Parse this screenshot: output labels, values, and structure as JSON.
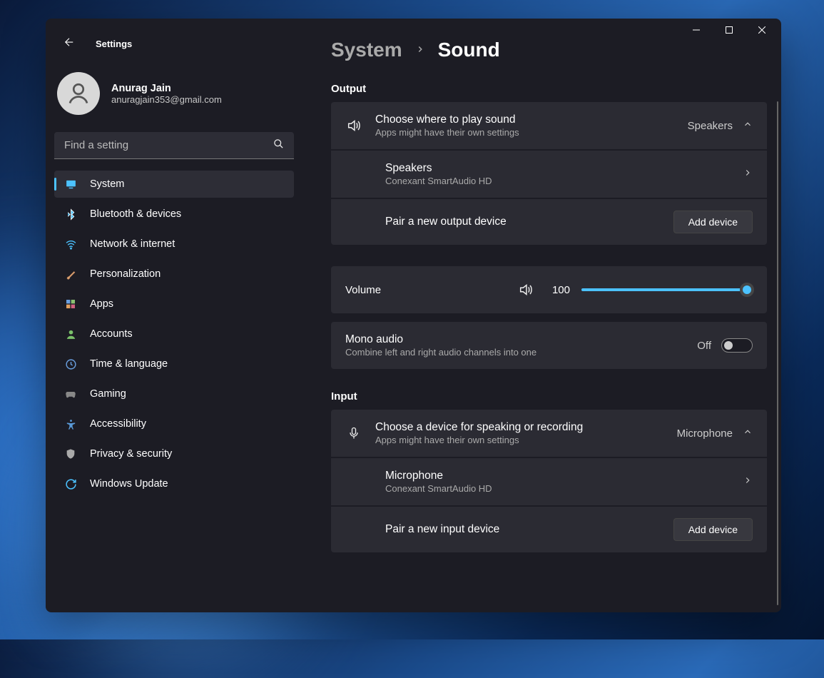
{
  "app_title": "Settings",
  "user": {
    "name": "Anurag Jain",
    "email": "anuragjain353@gmail.com"
  },
  "search": {
    "placeholder": "Find a setting"
  },
  "nav": [
    {
      "label": "System",
      "icon": "display",
      "active": true
    },
    {
      "label": "Bluetooth & devices",
      "icon": "bluetooth"
    },
    {
      "label": "Network & internet",
      "icon": "wifi"
    },
    {
      "label": "Personalization",
      "icon": "brush"
    },
    {
      "label": "Apps",
      "icon": "apps"
    },
    {
      "label": "Accounts",
      "icon": "person"
    },
    {
      "label": "Time & language",
      "icon": "clock"
    },
    {
      "label": "Gaming",
      "icon": "gamepad"
    },
    {
      "label": "Accessibility",
      "icon": "accessibility"
    },
    {
      "label": "Privacy & security",
      "icon": "shield"
    },
    {
      "label": "Windows Update",
      "icon": "update"
    }
  ],
  "breadcrumb": {
    "parent": "System",
    "current": "Sound"
  },
  "output": {
    "section": "Output",
    "choose_title": "Choose where to play sound",
    "choose_sub": "Apps might have their own settings",
    "selected": "Speakers",
    "device": {
      "name": "Speakers",
      "desc": "Conexant SmartAudio HD"
    },
    "pair_label": "Pair a new output device",
    "add_btn": "Add device",
    "volume_label": "Volume",
    "volume_value": "100",
    "mono_title": "Mono audio",
    "mono_sub": "Combine left and right audio channels into one",
    "mono_state": "Off"
  },
  "input": {
    "section": "Input",
    "choose_title": "Choose a device for speaking or recording",
    "choose_sub": "Apps might have their own settings",
    "selected": "Microphone",
    "device": {
      "name": "Microphone",
      "desc": "Conexant SmartAudio HD"
    },
    "pair_label": "Pair a new input device",
    "add_btn": "Add device"
  }
}
